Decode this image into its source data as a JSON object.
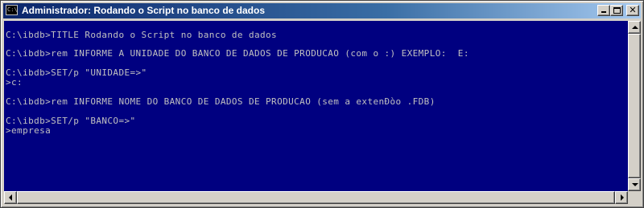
{
  "window": {
    "title": "Administrador:  Rodando o Script no banco de dados",
    "icon_label": "C:\\."
  },
  "colors": {
    "console_background": "#000080",
    "console_text": "#c0c0c0",
    "title_active": "#0a246a"
  },
  "controls": {
    "minimize": "minimize-icon",
    "maximize": "maximize-icon",
    "close": "✕"
  },
  "console": {
    "lines": [
      "C:\\ibdb>TITLE Rodando o Script no banco de dados",
      "C:\\ibdb>rem INFORME A UNIDADE DO BANCO DE DADOS DE PRODUCAO (com o :) EXEMPLO:  E:",
      "C:\\ibdb>SET/p \"UNIDADE=>\"",
      ">c:",
      "C:\\ibdb>rem INFORME NOME DO BANCO DE DADOS DE PRODUCAO (sem a extenÐòo .FDB)",
      "C:\\ibdb>SET/p \"BANCO=>\"",
      ">empresa"
    ]
  }
}
